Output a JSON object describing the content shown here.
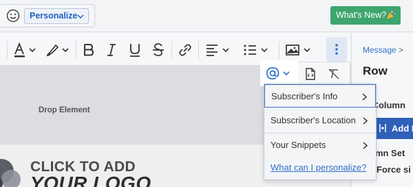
{
  "topbar": {
    "personalize_label": "Personalize",
    "whats_new_label": "What's New?"
  },
  "toolbar": {
    "icons": [
      "text-color-icon",
      "highlighter-icon",
      "bold-icon",
      "italic-icon",
      "underline-icon",
      "strikethrough-icon",
      "link-icon",
      "align-icon",
      "list-icon",
      "image-icon",
      "more-icon",
      "at-sign-icon",
      "code-icon",
      "clear-format-icon"
    ]
  },
  "canvas": {
    "drop_label": "Drop Element",
    "logo_line1": "CLICK TO ADD",
    "logo_line2": "YOUR LOGO"
  },
  "personalize_menu": {
    "items": [
      {
        "label": "Subscriber's Info",
        "active": true
      },
      {
        "label": "Subscriber's Location",
        "active": false
      },
      {
        "label": "Your Snippets",
        "active": false
      }
    ],
    "help_link": "What can I personalize?"
  },
  "right_panel": {
    "breadcrumb": "Message",
    "breadcrumb_arrow": ">",
    "title": "Row",
    "add_columns": "d Column",
    "add_button": "Add I",
    "column_settings": "umn Set",
    "force_setting": "Force si"
  },
  "colors": {
    "accent_blue": "#2f6fc9",
    "green_button": "#3ea56d",
    "add_button": "#2f5fb8"
  }
}
